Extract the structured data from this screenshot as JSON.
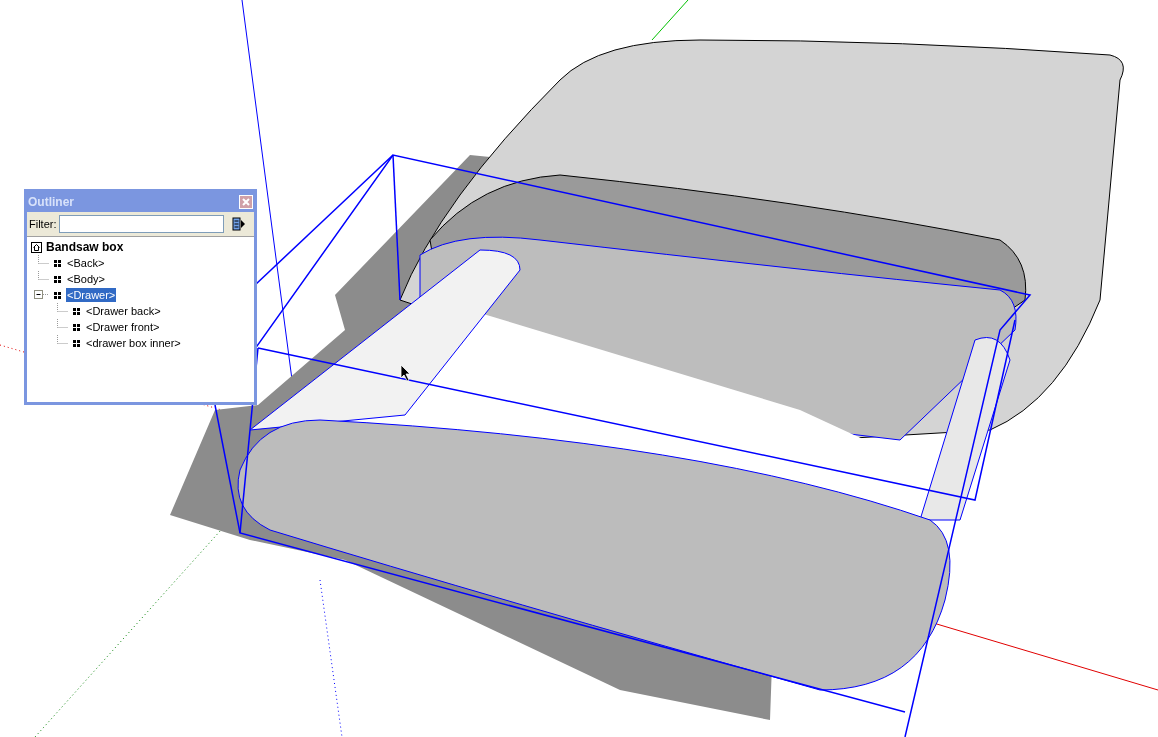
{
  "outliner": {
    "title": "Outliner",
    "filter": {
      "label": "Filter:"
    },
    "tree": [
      {
        "label": "Bandsaw box",
        "kind": "model",
        "selected": false,
        "children": [
          {
            "label": "<Back>",
            "kind": "group",
            "selected": false
          },
          {
            "label": "<Body>",
            "kind": "group",
            "selected": false
          },
          {
            "label": "<Drawer>",
            "kind": "group",
            "selected": true,
            "expanded": true,
            "children": [
              {
                "label": "<Drawer back>",
                "kind": "group",
                "selected": false
              },
              {
                "label": "<Drawer front>",
                "kind": "group",
                "selected": false
              },
              {
                "label": "<drawer box inner>",
                "kind": "group",
                "selected": false
              }
            ]
          }
        ]
      }
    ]
  }
}
